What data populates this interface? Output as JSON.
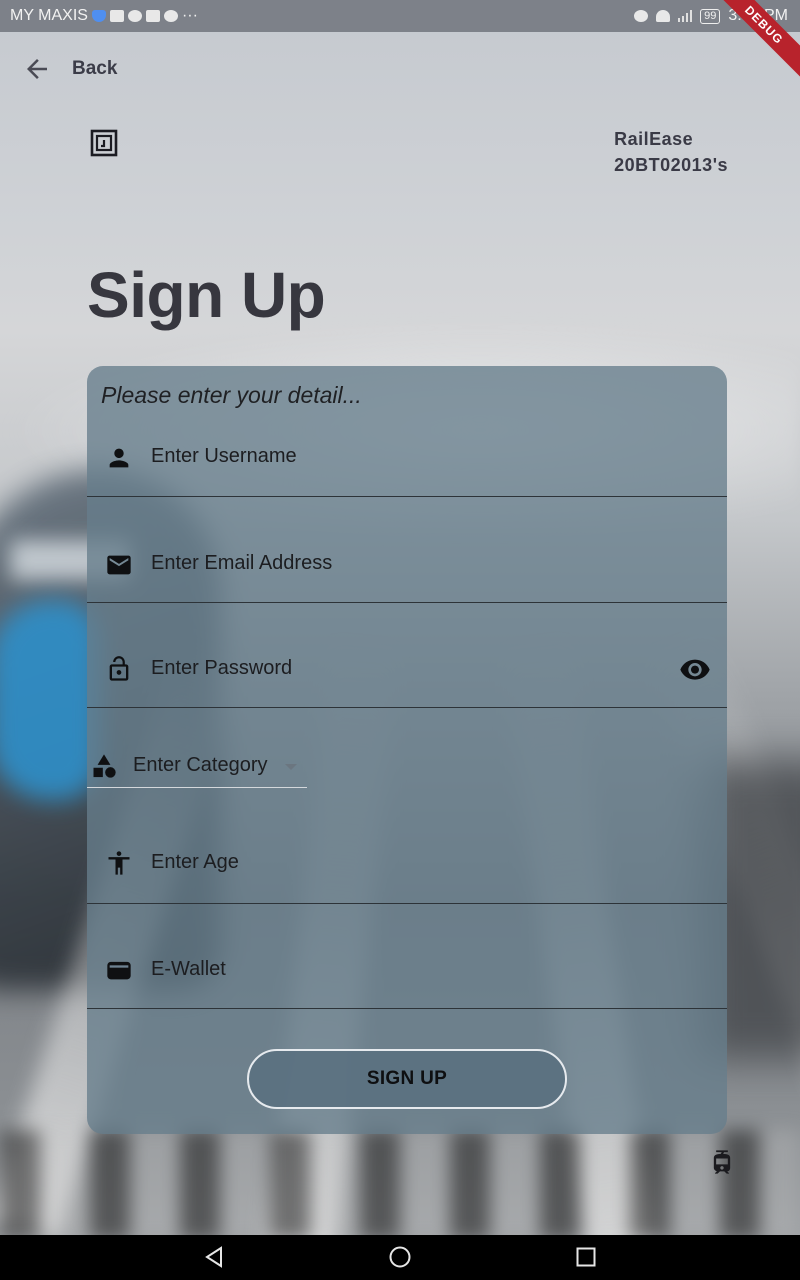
{
  "status_bar": {
    "carrier": "MY MAXIS",
    "dots": "···",
    "battery": "99",
    "time": "3:54 PM"
  },
  "debug_banner": "DEBUG",
  "app_bar": {
    "back_label": "Back"
  },
  "brand": {
    "line1": "RailEase",
    "line2": "20BT02013's"
  },
  "page": {
    "title": "Sign Up"
  },
  "form": {
    "subtitle": "Please enter your detail...",
    "username_placeholder": "Enter Username",
    "email_placeholder": "Enter Email Address",
    "password_placeholder": "Enter Password",
    "category_placeholder": "Enter Category",
    "age_placeholder": "Enter Age",
    "wallet_placeholder": "E-Wallet",
    "submit_label": "SIGN UP"
  },
  "colors": {
    "title": "#37373f",
    "card": "#677d8c",
    "debug_banner": "#b8232c"
  },
  "icons": [
    "back-arrow-icon",
    "logo-icon",
    "person-icon",
    "email-icon",
    "lock-icon",
    "eye-icon",
    "category-icon",
    "accessibility-icon",
    "wallet-icon",
    "tram-icon"
  ]
}
